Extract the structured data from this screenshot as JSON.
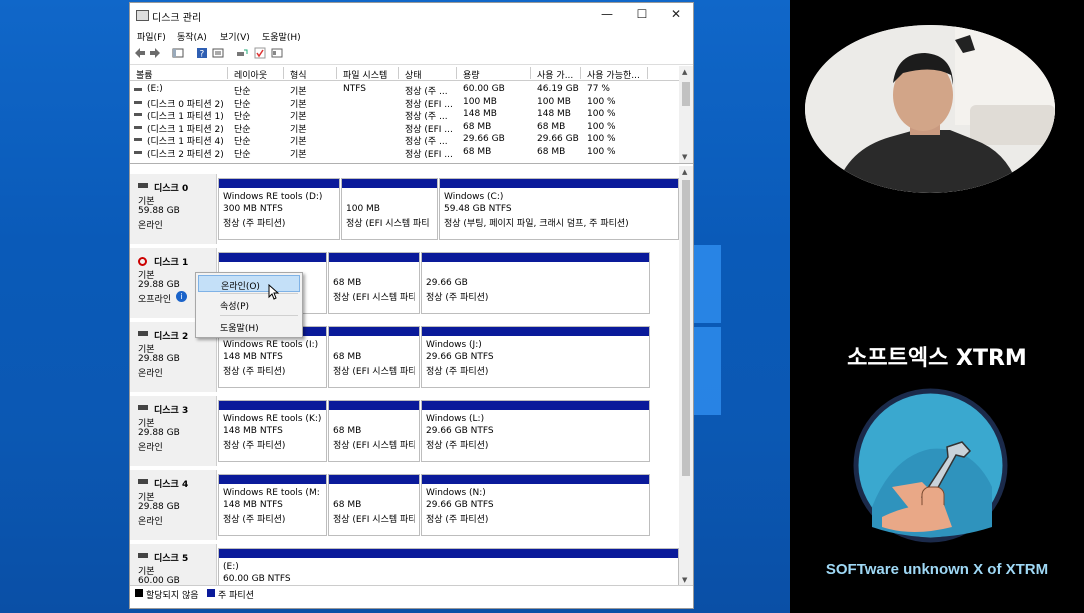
{
  "window": {
    "title": "디스크 관리",
    "minimize": "—",
    "maximize": "☐",
    "close": "✕"
  },
  "menu": [
    "파일(F)",
    "동작(A)",
    "보기(V)",
    "도움말(H)"
  ],
  "volume_table": {
    "headers": [
      "볼륨",
      "레이아웃",
      "형식",
      "파일 시스템",
      "상태",
      "용량",
      "사용 가...",
      "사용 가능한..."
    ],
    "rows": [
      [
        "(E:)",
        "단순",
        "기본",
        "NTFS",
        "정상 (주 ...",
        "60.00 GB",
        "46.19 GB",
        "77 %"
      ],
      [
        "(디스크 0 파티션 2)",
        "단순",
        "기본",
        "",
        "정상 (EFI ...",
        "100 MB",
        "100 MB",
        "100 %"
      ],
      [
        "(디스크 1 파티션 1)",
        "단순",
        "기본",
        "",
        "정상 (주 ...",
        "148 MB",
        "148 MB",
        "100 %"
      ],
      [
        "(디스크 1 파티션 2)",
        "단순",
        "기본",
        "",
        "정상 (EFI ...",
        "68 MB",
        "68 MB",
        "100 %"
      ],
      [
        "(디스크 1 파티션 4)",
        "단순",
        "기본",
        "",
        "정상 (주 ...",
        "29.66 GB",
        "29.66 GB",
        "100 %"
      ],
      [
        "(디스크 2 파티션 2)",
        "단순",
        "기본",
        "",
        "정상 (EFI ...",
        "68 MB",
        "68 MB",
        "100 %"
      ]
    ]
  },
  "disks": [
    {
      "name": "디스크 0",
      "type": "기본",
      "size": "59.88 GB",
      "status": "온라인",
      "parts": [
        {
          "l1": "Windows RE tools  (D:)",
          "l2": "300 MB NTFS",
          "l3": "정상 (주 파티션)"
        },
        {
          "l1": "",
          "l2": "100 MB",
          "l3": "정상 (EFI 시스템 파티"
        },
        {
          "l1": "Windows  (C:)",
          "l2": "59.48 GB NTFS",
          "l3": "정상 (부팅, 페이지 파일, 크래시 덤프, 주 파티션)"
        }
      ]
    },
    {
      "name": "디스크 1",
      "type": "기본",
      "size": "29.88 GB",
      "status": "오프라인",
      "parts": [
        {
          "l1": "",
          "l2": "",
          "l3": ""
        },
        {
          "l1": "",
          "l2": "68 MB",
          "l3": "정상 (EFI 시스템 파티"
        },
        {
          "l1": "",
          "l2": "29.66 GB",
          "l3": "정상 (주 파티션)"
        }
      ]
    },
    {
      "name": "디스크 2",
      "type": "기본",
      "size": "29.88 GB",
      "status": "온라인",
      "parts": [
        {
          "l1": "Windows RE tools  (I:)",
          "l2": "148 MB NTFS",
          "l3": "정상 (주 파티션)"
        },
        {
          "l1": "",
          "l2": "68 MB",
          "l3": "정상 (EFI 시스템 파티"
        },
        {
          "l1": "Windows  (J:)",
          "l2": "29.66 GB NTFS",
          "l3": "정상 (주 파티션)"
        }
      ]
    },
    {
      "name": "디스크 3",
      "type": "기본",
      "size": "29.88 GB",
      "status": "온라인",
      "parts": [
        {
          "l1": "Windows RE tools  (K:)",
          "l2": "148 MB NTFS",
          "l3": "정상 (주 파티션)"
        },
        {
          "l1": "",
          "l2": "68 MB",
          "l3": "정상 (EFI 시스템 파티"
        },
        {
          "l1": "Windows  (L:)",
          "l2": "29.66 GB NTFS",
          "l3": "정상 (주 파티션)"
        }
      ]
    },
    {
      "name": "디스크 4",
      "type": "기본",
      "size": "29.88 GB",
      "status": "온라인",
      "parts": [
        {
          "l1": "Windows RE tools  (M:",
          "l2": "148 MB NTFS",
          "l3": "정상 (주 파티션)"
        },
        {
          "l1": "",
          "l2": "68 MB",
          "l3": "정상 (EFI 시스템 파티"
        },
        {
          "l1": "Windows  (N:)",
          "l2": "29.66 GB NTFS",
          "l3": "정상 (주 파티션)"
        }
      ]
    },
    {
      "name": "디스크 5",
      "type": "기본",
      "size": "60.00 GB",
      "status": "",
      "parts": [
        {
          "l1": "(E:)",
          "l2": "60.00 GB NTFS",
          "l3": ""
        }
      ]
    }
  ],
  "context_menu": {
    "online": "온라인(O)",
    "properties": "속성(P)",
    "help": "도움말(H)"
  },
  "legend": {
    "unallocated": "할당되지 않음",
    "primary": "주 파티션",
    "unallocated_color": "#000000",
    "primary_color": "#0a1a9a"
  },
  "branding": {
    "title": "소프트엑스 XTRM",
    "subtitle": "SOFTware unknown X of XTRM"
  },
  "colors": {
    "desktop_blue": "#0b5cbf",
    "partition_bar": "#0a1a9a",
    "menu_highlight": "#c4e0f8",
    "offline_icon": "#cc0000"
  }
}
